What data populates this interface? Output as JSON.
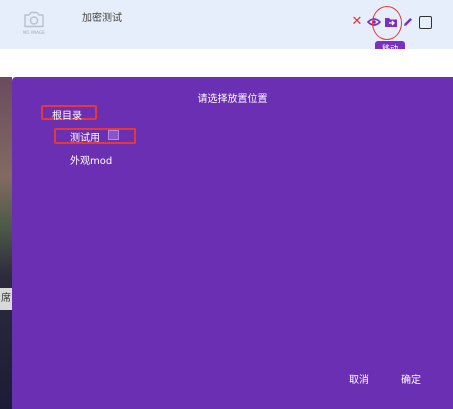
{
  "list_row": {
    "thumbnail_caption": "NO IMAGE",
    "title": "加密测试",
    "actions": {
      "close_icon": "close-icon",
      "eye_icon": "eye-icon",
      "move_icon": "move-icon",
      "edit_icon": "pencil-icon"
    },
    "move_tooltip": "移动"
  },
  "background": {
    "tab_fragment": "席"
  },
  "dialog": {
    "title": "请选择放置位置",
    "folders": {
      "root": "根目录",
      "children": [
        "测试用",
        "外观mod"
      ]
    },
    "cancel_label": "取消",
    "confirm_label": "确定"
  },
  "colors": {
    "dialog_bg": "#6b2fb3",
    "header_bg": "#e6eefb",
    "close": "#e53935",
    "action_purple": "#7a2fbe",
    "annotation_red": "#e53935"
  }
}
